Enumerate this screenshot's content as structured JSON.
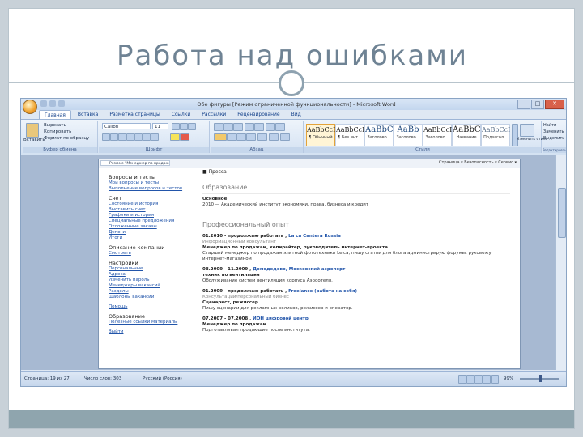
{
  "slide": {
    "title": "Работа над ошибками"
  },
  "window": {
    "title": "Обе фигуры [Режим ограниченной функциональности] - Microsoft Word",
    "controls": [
      "–",
      "□",
      "✕"
    ]
  },
  "ribbon": {
    "tabs": [
      "Главная",
      "Вставка",
      "Разметка страницы",
      "Ссылки",
      "Рассылки",
      "Рецензирование",
      "Вид"
    ],
    "active_tab": "Главная",
    "groups": {
      "clipboard": {
        "label": "Буфер обмена",
        "paste": "Вставить",
        "cut": "Вырезать",
        "copy": "Копировать",
        "format": "Формат по образцу"
      },
      "font": {
        "label": "Шрифт",
        "font_name": "Calibri",
        "font_size": "11"
      },
      "paragraph": {
        "label": "Абзац"
      },
      "styles": {
        "label": "Стили",
        "items": [
          {
            "preview": "AaBbCcI",
            "name": "¶ Обычный"
          },
          {
            "preview": "AaBbCcI",
            "name": "¶ Без инт..."
          },
          {
            "preview": "AaBbC",
            "name": "Заголово..."
          },
          {
            "preview": "AaBb",
            "name": "Заголово..."
          },
          {
            "preview": "AaBbCcI",
            "name": "Заголово..."
          },
          {
            "preview": "AaBbC",
            "name": "Название"
          },
          {
            "preview": "AaBbCcI",
            "name": "Подзагол..."
          }
        ],
        "change_styles": "Изменить стили"
      },
      "editing": {
        "label": "Редактирование",
        "find": "Найти",
        "replace": "Заменить",
        "select": "Выделить"
      }
    }
  },
  "document": {
    "browser_tab": "Резюме \"Менеджер по продаже\"",
    "browser_tools": "Страница ▾  Безопасность ▾  Сервис ▾",
    "nav": [
      {
        "heading": "Вопросы и тесты",
        "links": [
          "Мои вопросы и тесты",
          "Выполнение вопросов и тестов"
        ]
      },
      {
        "heading": "Счет",
        "links": [
          "Состояние и история",
          "Выставить счет",
          "Графики и история",
          "Специальные предложения",
          "Отложенные заказы",
          "Деньги",
          "Итоги"
        ]
      },
      {
        "heading": "Описание компании",
        "links": [
          "Смотреть"
        ]
      },
      {
        "heading": "Настройки",
        "links": [
          "Персональные",
          "Адреса",
          "Изменить пароль",
          "Менеджеры вакансий",
          "Разделы",
          "Шаблоны вакансий"
        ]
      },
      {
        "heading": "",
        "links": [
          "Помощь"
        ]
      },
      {
        "heading": "Образование",
        "links": [
          "Полезные ссылки материалы"
        ]
      },
      {
        "heading": "",
        "links": [
          "Выйти"
        ]
      }
    ],
    "content": {
      "bullet": "■ Пресса",
      "education_title": "Образование",
      "education_level": "Основное",
      "education_entry": "2010 — Академический институт экономики, права, бизнеса и кредит",
      "experience_title": "Профессиональный опыт",
      "jobs": [
        {
          "period": "01.2010 - продолжаю работать ,",
          "company": "La ca Cantera Russia",
          "industry": "Информационный консультант",
          "position": "Менеджер по продажам, копирайтер, руководитель интернет-проекта",
          "description": "Старший менеджер по продажам элитной фототехники Leica, пишу статьи для блога администрирую форумы, руковожу интернет-магазином"
        },
        {
          "period": "08.2009 - 11.2009 ,",
          "company": "Домодедово, Московский аэропорт",
          "industry": "",
          "position": "техник по вентиляции",
          "description": "Обслуживание систем вентиляции корпуса Аэроотеля."
        },
        {
          "period": "01.2009 - продолжаю работать ,",
          "company": "Freelance (работа на себя)",
          "industry": "Консультации/персональный бизнес",
          "position": "Сценарист, режиссер",
          "description": "Пишу сценарии для рекламных роликов, режиссер и оператор."
        },
        {
          "period": "07.2007 - 07.2008 ,",
          "company": "ИОН цифровой центр",
          "industry": "",
          "position": "Менеджер по продажам",
          "description": "Подготавливал продающие после института."
        }
      ]
    }
  },
  "statusbar": {
    "page": "Страница: 19 из 27",
    "words": "Число слов: 303",
    "language": "Русский (Россия)",
    "zoom": "99%"
  }
}
